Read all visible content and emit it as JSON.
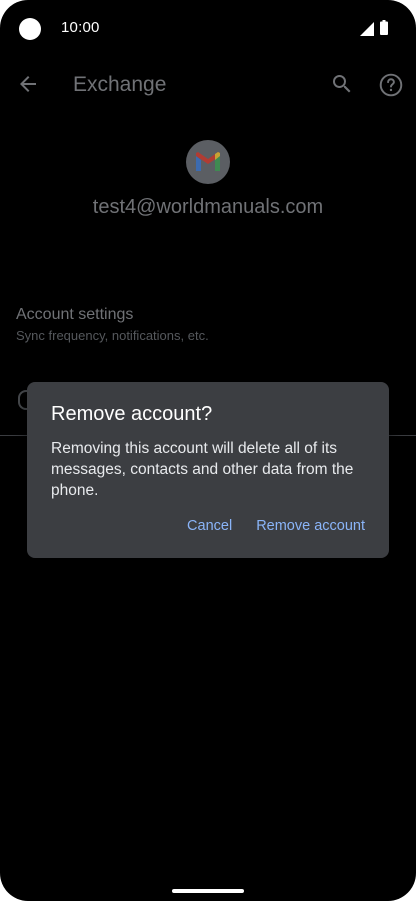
{
  "status_bar": {
    "time": "10:00",
    "icons": [
      "camera-cutout",
      "signal-icon",
      "battery-icon"
    ]
  },
  "app_bar": {
    "title": "Exchange",
    "icons": [
      "back-arrow-icon",
      "search-icon",
      "help-icon"
    ]
  },
  "account": {
    "icon": "gmail-icon",
    "email": "test4@worldmanuals.com"
  },
  "settings": {
    "items": [
      {
        "title": "Account settings",
        "subtitle": "Sync frequency, notifications, etc."
      }
    ]
  },
  "dialog": {
    "title": "Remove account?",
    "message": "Removing this account will delete all of its messages, contacts and other data from the phone.",
    "cancel_label": "Cancel",
    "confirm_label": "Remove account"
  },
  "colors": {
    "background": "#000000",
    "dialog_surface": "#3c3e42",
    "accent": "#8ab4f8",
    "dimmed_text": "#707276"
  }
}
